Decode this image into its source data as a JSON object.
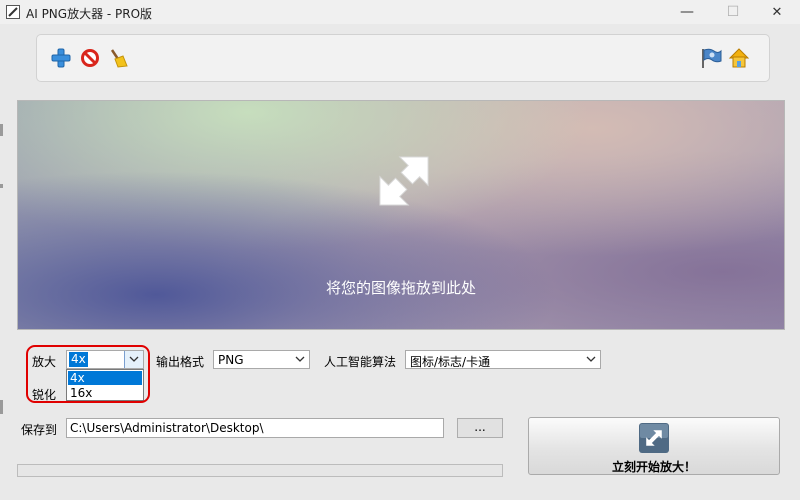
{
  "window": {
    "title": "AI PNG放大器 - PRO版",
    "minimize_glyph": "—",
    "maximize_glyph": "☐",
    "close_glyph": "✕"
  },
  "toolbar": {
    "icons": [
      "add-icon",
      "remove-icon",
      "clear-broom-icon",
      "language-flag-icon",
      "home-icon"
    ]
  },
  "dropzone": {
    "prompt": "将您的图像拖放到此处",
    "icon": "resize-arrows-icon"
  },
  "settings": {
    "scale_label": "放大",
    "scale_value": "4x",
    "scale_options": [
      "4x",
      "16x"
    ],
    "sharpen_label": "锐化",
    "format_label": "输出格式",
    "format_value": "PNG",
    "algo_label": "人工智能算法",
    "algo_value": "图标/标志/卡通"
  },
  "save": {
    "label": "保存到",
    "path": "C:\\Users\\Administrator\\Desktop\\",
    "browse_label": "..."
  },
  "progress": {
    "value": 0
  },
  "start": {
    "label": "立刻开始放大！",
    "icon": "enlarge-icon"
  },
  "colors": {
    "selection": "#0078d7",
    "highlight": "#e00000"
  }
}
